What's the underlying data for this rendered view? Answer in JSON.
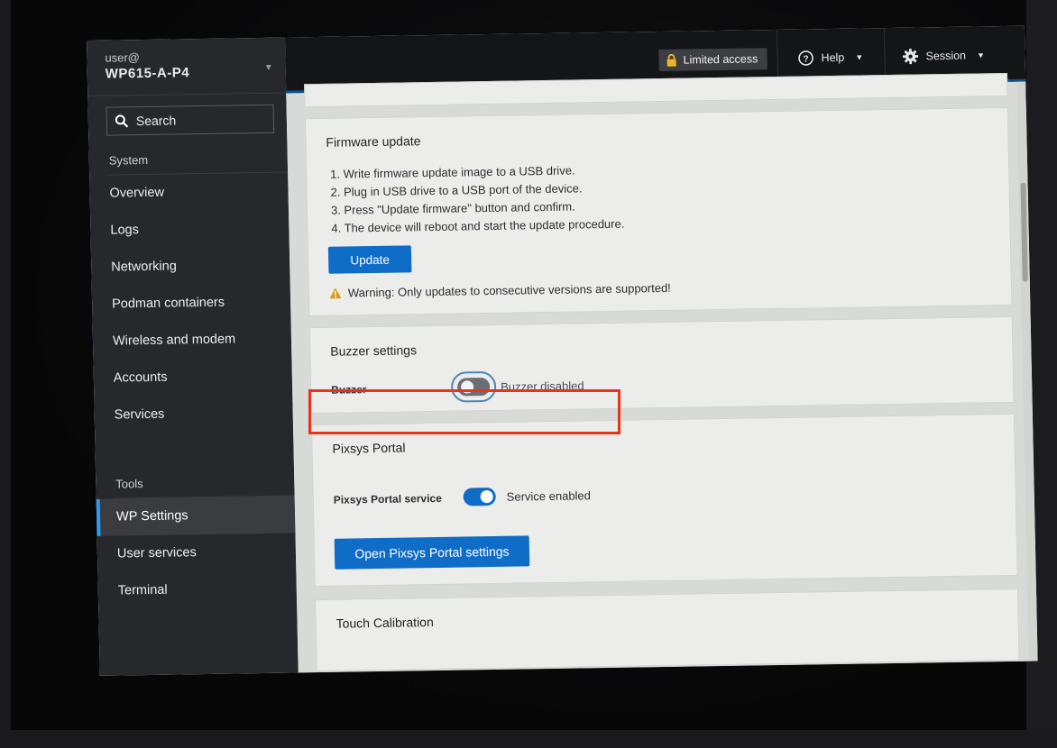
{
  "sidebar": {
    "user": "user@",
    "hostname": "WP615-A-P4",
    "search_placeholder": "Search",
    "system_label": "System",
    "system_items": [
      {
        "label": "Overview"
      },
      {
        "label": "Logs"
      },
      {
        "label": "Networking"
      },
      {
        "label": "Podman containers"
      },
      {
        "label": "Wireless and modem"
      },
      {
        "label": "Accounts"
      },
      {
        "label": "Services"
      }
    ],
    "tools_label": "Tools",
    "tools_items": [
      {
        "label": "WP Settings",
        "active": true
      },
      {
        "label": "User services"
      },
      {
        "label": "Terminal"
      }
    ]
  },
  "topbar": {
    "limited_access": "Limited access",
    "help": "Help",
    "session": "Session"
  },
  "firmware": {
    "title": "Firmware update",
    "steps": [
      "1. Write firmware update image to a USB drive.",
      "2. Plug in USB drive to a USB port of the device.",
      "3. Press \"Update firmware\" button and confirm.",
      "4. The device will reboot and start the update procedure."
    ],
    "update_button": "Update",
    "warning": "Warning: Only updates to consecutive versions are supported!"
  },
  "buzzer": {
    "title": "Buzzer settings",
    "label": "Buzzer",
    "state_text": "Buzzer disabled",
    "enabled": false
  },
  "portal": {
    "title": "Pixsys Portal",
    "label": "Pixsys Portal service",
    "state_text": "Service enabled",
    "enabled": true,
    "open_button": "Open Pixsys Portal settings"
  },
  "touch": {
    "title": "Touch Calibration"
  },
  "colors": {
    "accent": "#0f6cc7",
    "highlight": "#e8321c",
    "sidebar_bg": "#26282b"
  }
}
